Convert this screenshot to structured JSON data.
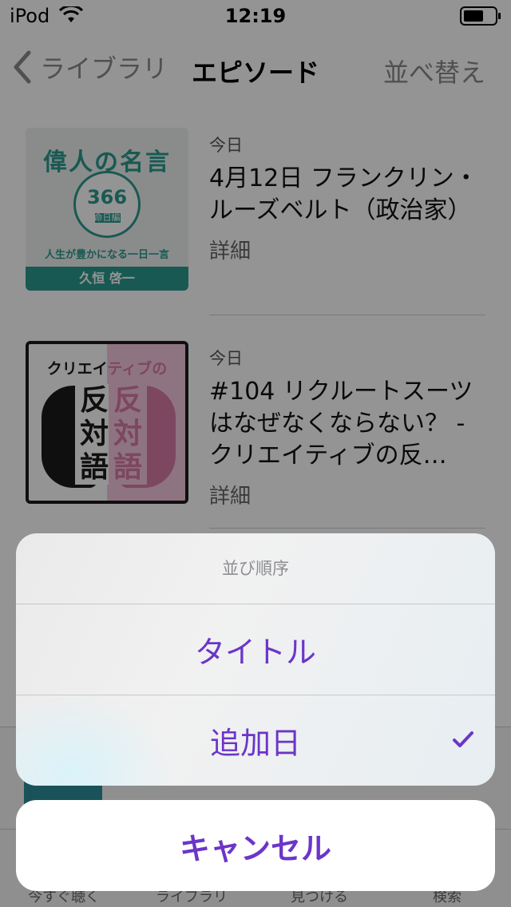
{
  "status_bar": {
    "carrier": "iPod",
    "time": "12:19"
  },
  "nav": {
    "back_label": "ライブラリ",
    "title": "エピソード",
    "sort_label": "並べ替え"
  },
  "episodes": [
    {
      "date": "今日",
      "title": "4月12日 フランクリン・ルーズベルト（政治家）",
      "detail": "詳細",
      "art": {
        "title": "偉人の名言",
        "number": "366",
        "sub": "命日編",
        "tagline": "人生が豊かになる一日一言",
        "author": "久恒 啓一"
      }
    },
    {
      "date": "今日",
      "title": "#104 リクルートスーツはなぜなくならない？ - クリエイティブの反…",
      "detail": "詳細",
      "art": {
        "head_a": "クリエイ",
        "head_b": "ティブの",
        "words_left": "反対語",
        "words_right": "反対語"
      }
    }
  ],
  "tabs": [
    "今すぐ聴く",
    "ライブラリ",
    "見つける",
    "検索"
  ],
  "action_sheet": {
    "header": "並び順序",
    "options": [
      {
        "label": "タイトル",
        "selected": false
      },
      {
        "label": "追加日",
        "selected": true
      }
    ],
    "cancel_label": "キャンセル"
  },
  "colors": {
    "accent": "#6b35c9",
    "teal": "#2c9a8f",
    "pink": "#d77aa6"
  }
}
